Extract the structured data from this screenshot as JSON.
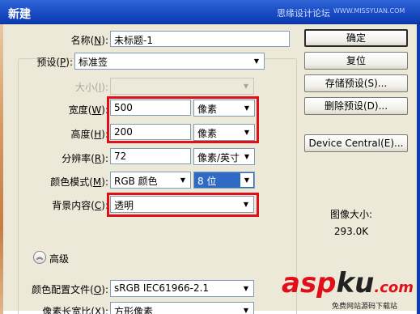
{
  "window": {
    "title": "新建",
    "watermark": "思缘设计论坛",
    "watermark_url": "WWW.MISSYUAN.COM"
  },
  "form": {
    "name_label": "名称(",
    "name_key": "N",
    "name_tail": "):",
    "name_value": "未标题-1",
    "preset_label": "预设(",
    "preset_key": "P",
    "preset_tail": "):",
    "preset_value": "标准签",
    "size_label": "大小(",
    "size_key": "I",
    "size_tail": "):",
    "size_value": "",
    "width_label": "宽度(",
    "width_key": "W",
    "width_tail": "):",
    "width_value": "500",
    "width_unit": "像素",
    "height_label": "高度(",
    "height_key": "H",
    "height_tail": "):",
    "height_value": "200",
    "height_unit": "像素",
    "resolution_label": "分辨率(",
    "resolution_key": "R",
    "resolution_tail": "):",
    "resolution_value": "72",
    "resolution_unit": "像素/英寸",
    "color_mode_label": "颜色模式(",
    "color_mode_key": "M",
    "color_mode_tail": "):",
    "color_mode_value": "RGB 颜色",
    "bit_depth_value": "8 位",
    "background_label": "背景内容(",
    "background_key": "C",
    "background_tail": "):",
    "background_value": "透明",
    "advanced_label": "高级",
    "color_profile_label": "颜色配置文件(",
    "color_profile_key": "O",
    "color_profile_tail": "):",
    "color_profile_value": "sRGB IEC61966-2.1",
    "pixel_aspect_label": "像素长宽比(",
    "pixel_aspect_key": "X",
    "pixel_aspect_tail": "):",
    "pixel_aspect_value": "方形像素"
  },
  "buttons": {
    "ok": "确定",
    "reset": "复位",
    "save_preset": "存储预设(S)...",
    "delete_preset": "删除预设(D)...",
    "device_central": "Device Central(E)..."
  },
  "info": {
    "image_size_label": "图像大小:",
    "image_size_value": "293.0K"
  },
  "icons": {
    "dropdown": "chevron-down-icon",
    "advanced": "double-chevron-up-icon"
  },
  "colors": {
    "titlebar": "#0a3bb2",
    "dialog_bg": "#ece9d8",
    "highlight_box": "#e0101a",
    "selected_item": "#316ac5"
  },
  "brand": {
    "logo_part1": "asp",
    "logo_part2": "ku",
    "logo_part3": ".com",
    "logo_sub": "免费网站源码下载站"
  }
}
